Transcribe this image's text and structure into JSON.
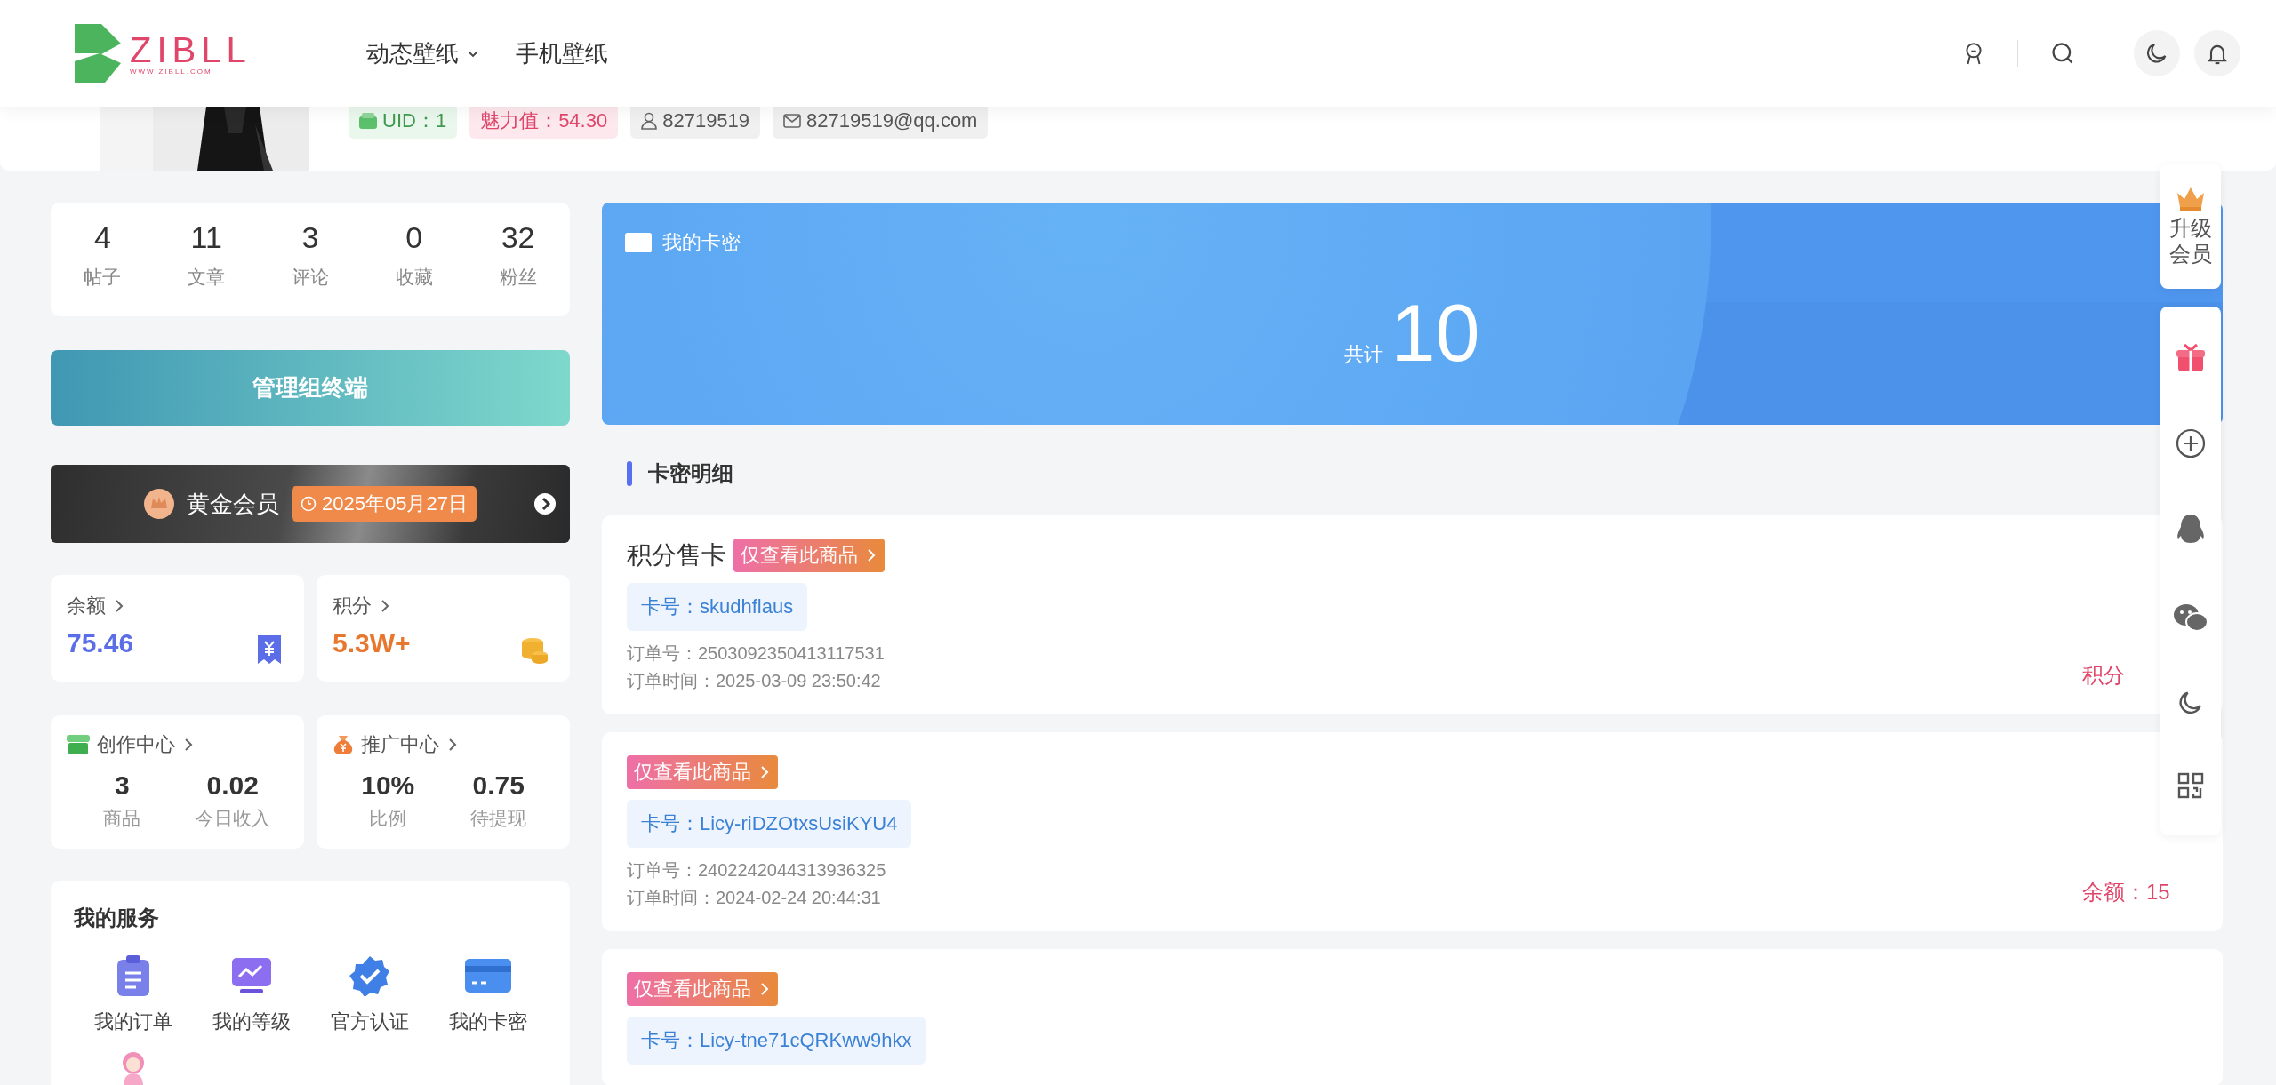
{
  "header": {
    "logo": {
      "text": "ZIBLL",
      "sub": "WWW.ZIBLL.COM"
    },
    "nav": [
      {
        "label": "动态壁纸",
        "dropdown": true
      },
      {
        "label": "手机壁纸",
        "dropdown": false
      }
    ]
  },
  "profile": {
    "badges": [
      {
        "kind": "uid",
        "text": "UID：1"
      },
      {
        "kind": "charm",
        "text": "魅力值：54.30"
      },
      {
        "kind": "qq",
        "text": "82719519"
      },
      {
        "kind": "email",
        "text": "82719519@qq.com"
      }
    ]
  },
  "stats": [
    {
      "value": "4",
      "label": "帖子"
    },
    {
      "value": "11",
      "label": "文章"
    },
    {
      "value": "3",
      "label": "评论"
    },
    {
      "value": "0",
      "label": "收藏"
    },
    {
      "value": "32",
      "label": "粉丝"
    }
  ],
  "admin_button": "管理组终端",
  "vip": {
    "name": "黄金会员",
    "expiry": "2025年05月27日"
  },
  "wallet": [
    {
      "kind": "balance",
      "label": "余额",
      "value": "75.46"
    },
    {
      "kind": "points",
      "label": "积分",
      "value": "5.3W+"
    }
  ],
  "centers": [
    {
      "kind": "creation",
      "title": "创作中心",
      "items": [
        {
          "value": "3",
          "label": "商品"
        },
        {
          "value": "0.02",
          "label": "今日收入"
        }
      ]
    },
    {
      "kind": "promotion",
      "title": "推广中心",
      "items": [
        {
          "value": "10%",
          "label": "比例"
        },
        {
          "value": "0.75",
          "label": "待提现"
        }
      ]
    }
  ],
  "services": {
    "title": "我的服务",
    "items": [
      {
        "kind": "orders",
        "label": "我的订单"
      },
      {
        "kind": "level",
        "label": "我的等级"
      },
      {
        "kind": "verify",
        "label": "官方认证"
      },
      {
        "kind": "cards",
        "label": "我的卡密"
      },
      {
        "kind": "figure"
      }
    ]
  },
  "banner": {
    "title": "我的卡密",
    "total_label": "共计",
    "total": "10"
  },
  "section_title": "卡密明细",
  "cards": [
    {
      "title": "积分售卡",
      "tag": "仅查看此商品",
      "card_no": "卡号：skudhflaus",
      "order_no": "订单号：2503092350413117531",
      "order_time": "订单时间：2025-03-09 23:50:42",
      "amount": "积分"
    },
    {
      "tag": "仅查看此商品",
      "card_no": "卡号：Licy-riDZOtxsUsiKYU4",
      "order_no": "订单号：2402242044313936325",
      "order_time": "订单时间：2024-02-24 20:44:31",
      "amount": "余额：15"
    },
    {
      "tag": "仅查看此商品",
      "card_no": "卡号：Licy-tne71cQRKww9hkx"
    }
  ],
  "float_bar": {
    "upgrade": "升级会员",
    "tools": [
      {
        "kind": "gift"
      },
      {
        "kind": "add"
      },
      {
        "kind": "penguin"
      },
      {
        "kind": "chat"
      },
      {
        "kind": "moon"
      },
      {
        "kind": "qr"
      }
    ]
  }
}
